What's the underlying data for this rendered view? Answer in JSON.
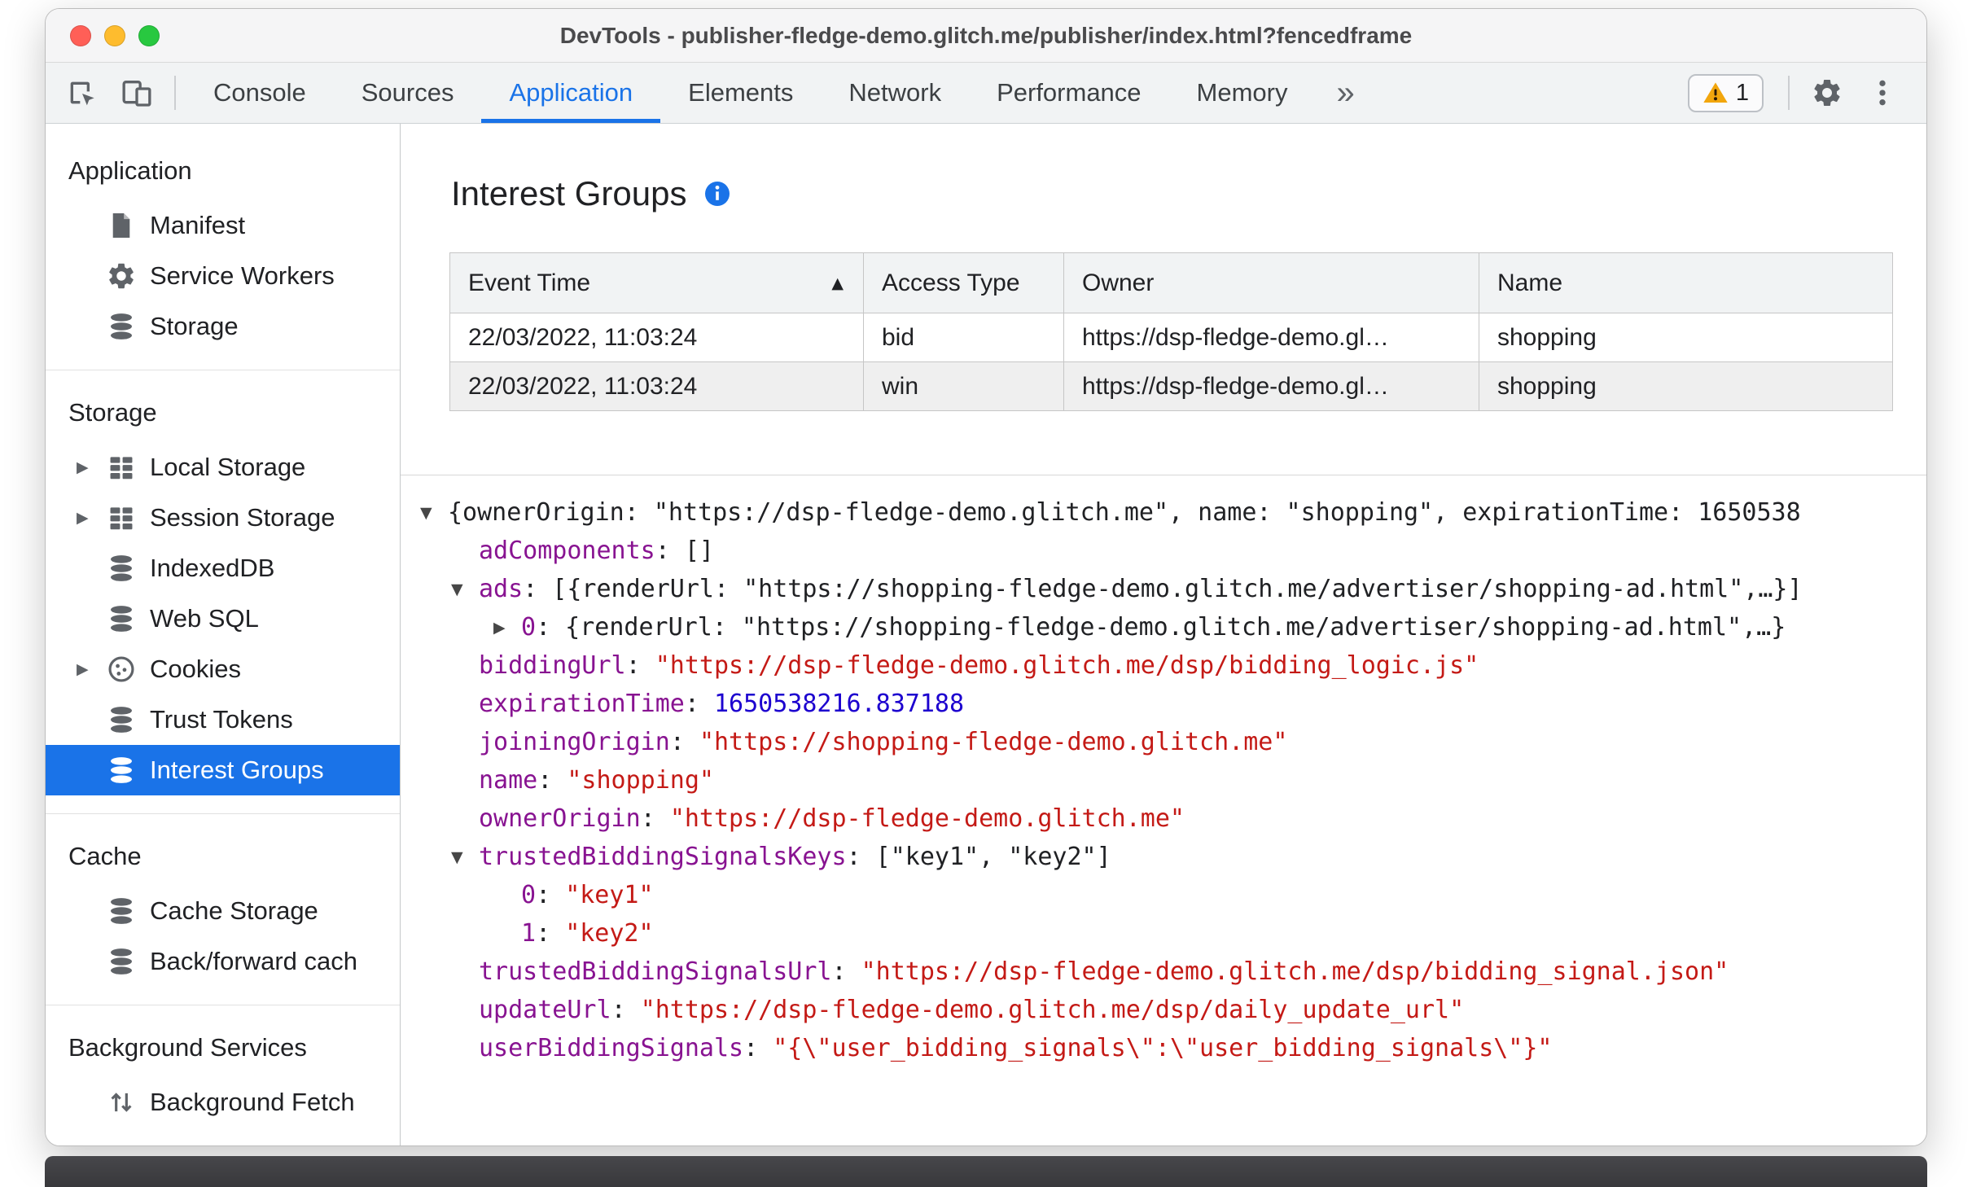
{
  "window": {
    "title": "DevTools - publisher-fledge-demo.glitch.me/publisher/index.html?fencedframe"
  },
  "toolbar": {
    "left_icons": [
      "inspect-icon",
      "device-toolbar-icon"
    ],
    "tabs": [
      "Console",
      "Sources",
      "Application",
      "Elements",
      "Network",
      "Performance",
      "Memory"
    ],
    "active_tab": "Application",
    "more_tabs_glyph": "»",
    "warning_count": "1",
    "right_icons": [
      "issues-warning-icon",
      "settings-gear-icon",
      "menu-dots-icon"
    ]
  },
  "sidebar": {
    "sections": [
      {
        "header": "Application",
        "items": [
          {
            "label": "Manifest",
            "icon": "document-icon"
          },
          {
            "label": "Service Workers",
            "icon": "gear-icon"
          },
          {
            "label": "Storage",
            "icon": "database-icon"
          }
        ]
      },
      {
        "header": "Storage",
        "items": [
          {
            "label": "Local Storage",
            "icon": "table-icon",
            "arrow": "collapsed"
          },
          {
            "label": "Session Storage",
            "icon": "table-icon",
            "arrow": "collapsed"
          },
          {
            "label": "IndexedDB",
            "icon": "database-icon"
          },
          {
            "label": "Web SQL",
            "icon": "database-icon"
          },
          {
            "label": "Cookies",
            "icon": "cookie-icon",
            "arrow": "collapsed"
          },
          {
            "label": "Trust Tokens",
            "icon": "database-icon"
          },
          {
            "label": "Interest Groups",
            "icon": "database-icon",
            "selected": true
          }
        ]
      },
      {
        "header": "Cache",
        "items": [
          {
            "label": "Cache Storage",
            "icon": "database-icon"
          },
          {
            "label": "Back/forward cach",
            "icon": "database-icon"
          }
        ]
      },
      {
        "header": "Background Services",
        "items": [
          {
            "label": "Background Fetch",
            "icon": "fetch-icon"
          }
        ]
      }
    ]
  },
  "main": {
    "title": "Interest Groups",
    "title_info_icon": "info-icon",
    "table": {
      "columns": [
        "Event Time",
        "Access Type",
        "Owner",
        "Name"
      ],
      "sort": {
        "column": "Event Time",
        "direction": "asc"
      },
      "rows": [
        [
          "22/03/2022, 11:03:24",
          "bid",
          "https://dsp-fledge-demo.gl…",
          "shopping"
        ],
        [
          "22/03/2022, 11:03:24",
          "win",
          "https://dsp-fledge-demo.gl…",
          "shopping"
        ]
      ]
    },
    "tree": {
      "lines": [
        {
          "indent": 0,
          "arrow": "expanded",
          "segs": [
            [
              "p",
              "{ownerOrigin: \"https://dsp-fledge-demo.glitch.me\", name: \"shopping\", expirationTime: 1650538"
            ]
          ]
        },
        {
          "indent": 1,
          "arrow": null,
          "segs": [
            [
              "k",
              "adComponents"
            ],
            [
              "p",
              ": []"
            ]
          ]
        },
        {
          "indent": 1,
          "arrow": "expanded",
          "segs": [
            [
              "k",
              "ads"
            ],
            [
              "p",
              ": [{renderUrl: \"https://shopping-fledge-demo.glitch.me/advertiser/shopping-ad.html\",…}]"
            ]
          ]
        },
        {
          "indent": 2,
          "arrow": "collapsed",
          "segs": [
            [
              "k",
              "0"
            ],
            [
              "p",
              ": {renderUrl: \"https://shopping-fledge-demo.glitch.me/advertiser/shopping-ad.html\",…}"
            ]
          ]
        },
        {
          "indent": 1,
          "arrow": null,
          "segs": [
            [
              "k",
              "biddingUrl"
            ],
            [
              "p",
              ": "
            ],
            [
              "s",
              "\"https://dsp-fledge-demo.glitch.me/dsp/bidding_logic.js\""
            ]
          ]
        },
        {
          "indent": 1,
          "arrow": null,
          "segs": [
            [
              "k",
              "expirationTime"
            ],
            [
              "p",
              ": "
            ],
            [
              "n",
              "1650538216.837188"
            ]
          ]
        },
        {
          "indent": 1,
          "arrow": null,
          "segs": [
            [
              "k",
              "joiningOrigin"
            ],
            [
              "p",
              ": "
            ],
            [
              "s",
              "\"https://shopping-fledge-demo.glitch.me\""
            ]
          ]
        },
        {
          "indent": 1,
          "arrow": null,
          "segs": [
            [
              "k",
              "name"
            ],
            [
              "p",
              ": "
            ],
            [
              "s",
              "\"shopping\""
            ]
          ]
        },
        {
          "indent": 1,
          "arrow": null,
          "segs": [
            [
              "k",
              "ownerOrigin"
            ],
            [
              "p",
              ": "
            ],
            [
              "s",
              "\"https://dsp-fledge-demo.glitch.me\""
            ]
          ]
        },
        {
          "indent": 1,
          "arrow": "expanded",
          "segs": [
            [
              "k",
              "trustedBiddingSignalsKeys"
            ],
            [
              "p",
              ": [\"key1\", \"key2\"]"
            ]
          ]
        },
        {
          "indent": 2,
          "arrow": null,
          "segs": [
            [
              "k",
              "0"
            ],
            [
              "p",
              ": "
            ],
            [
              "s",
              "\"key1\""
            ]
          ]
        },
        {
          "indent": 2,
          "arrow": null,
          "segs": [
            [
              "k",
              "1"
            ],
            [
              "p",
              ": "
            ],
            [
              "s",
              "\"key2\""
            ]
          ]
        },
        {
          "indent": 1,
          "arrow": null,
          "segs": [
            [
              "k",
              "trustedBiddingSignalsUrl"
            ],
            [
              "p",
              ": "
            ],
            [
              "s",
              "\"https://dsp-fledge-demo.glitch.me/dsp/bidding_signal.json\""
            ]
          ]
        },
        {
          "indent": 1,
          "arrow": null,
          "segs": [
            [
              "k",
              "updateUrl"
            ],
            [
              "p",
              ": "
            ],
            [
              "s",
              "\"https://dsp-fledge-demo.glitch.me/dsp/daily_update_url\""
            ]
          ]
        },
        {
          "indent": 1,
          "arrow": null,
          "segs": [
            [
              "k",
              "userBiddingSignals"
            ],
            [
              "p",
              ": "
            ],
            [
              "s",
              "\"{\\\"user_bidding_signals\\\":\\\"user_bidding_signals\\\"}\""
            ]
          ]
        }
      ]
    }
  }
}
